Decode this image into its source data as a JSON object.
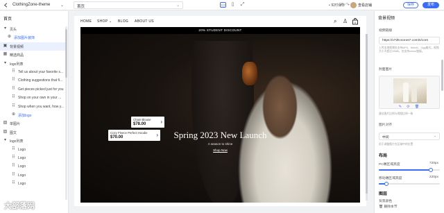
{
  "topbar": {
    "title": "ClothingZone-theme",
    "page_select": "首页",
    "save_state": "• 实时保存",
    "user": "查看店铺",
    "save_label": "保存",
    "publish_label": "发布"
  },
  "left": {
    "title": "首页",
    "rows": [
      {
        "label": "页头",
        "icon": "caret-down",
        "indent": 0
      },
      {
        "label": "添加图片装饰",
        "icon": "plus",
        "indent": 1,
        "blue": true
      },
      {
        "label": "背景视频",
        "icon": "video",
        "indent": 0,
        "selected": true
      },
      {
        "label": "精选商品",
        "icon": "grid",
        "indent": 0
      },
      {
        "label": "logo列表",
        "icon": "caret-down",
        "indent": 0
      },
      {
        "label": "Tell us about your favorite s...",
        "icon": "drag",
        "indent": 2
      },
      {
        "label": "Clothing suggestions that fi...",
        "icon": "drag",
        "indent": 2
      },
      {
        "label": "Get pieces picked just for you",
        "icon": "drag",
        "indent": 2
      },
      {
        "label": "Shop on your own in your ...",
        "icon": "drag",
        "indent": 2
      },
      {
        "label": "Shop when you want, how y...",
        "icon": "drag",
        "indent": 2
      },
      {
        "label": "添加logo",
        "icon": "plus",
        "indent": 2,
        "blue": true
      },
      {
        "label": "单图片",
        "icon": "image",
        "indent": 0
      },
      {
        "label": "图文",
        "icon": "image",
        "indent": 0
      },
      {
        "label": "logo列表",
        "icon": "caret-down",
        "indent": 0
      },
      {
        "label": "Logo",
        "icon": "drag",
        "indent": 2
      },
      {
        "label": "Logo",
        "icon": "drag",
        "indent": 2
      },
      {
        "label": "Logo",
        "icon": "drag",
        "indent": 2
      },
      {
        "label": "Logo",
        "icon": "drag",
        "indent": 2
      },
      {
        "label": "Logo",
        "icon": "drag",
        "indent": 2
      }
    ]
  },
  "store": {
    "nav": [
      "HOME",
      "SHOP ⌄",
      "BLOG",
      "ABOUT US"
    ],
    "announcement": "20% STUDENT DISCOUNT",
    "hero_title": "Spring 2023 New Launch",
    "hero_sub": "A season to shine",
    "hero_link": "Shop Now",
    "tag1": {
      "name": "Chain Blouse",
      "price": "$78.00"
    },
    "tag2": {
      "name": "Cozy Fleece Perfect Hoodie",
      "price": "$70.00"
    }
  },
  "right": {
    "title": "背景视频",
    "video_link_label": "视频链接",
    "video_link_value": "https://v7d9.sceos7.com/s/cont",
    "video_help": "上传本地视频仅支持MP4、WebM、Ogg格式，视频大小不超过10MB，仅支持vimeo链接。",
    "cover_label": "封面图片",
    "cover_actions": "✎ ⟳ 🗑",
    "cover_help": "建议图片比例与视频比例一致",
    "align_label": "图片对齐",
    "align_value": "中间",
    "align_help": "用于调整图片在区域中的位置",
    "layout_heading": "布局",
    "pc_height_label": "PC端区域高度",
    "pc_height_value": "720px",
    "pc_height_fraction": 0.85,
    "mobile_height_label": "移动端区域高度",
    "mobile_height_value": "220px",
    "mobile_height_fraction": 0.12,
    "layer_heading": "图层",
    "bg_color_label": "背景颜色",
    "delete_label": "删除本节"
  },
  "watermark": "大部落网",
  "colors": {
    "accent": "#3b6cf6"
  }
}
